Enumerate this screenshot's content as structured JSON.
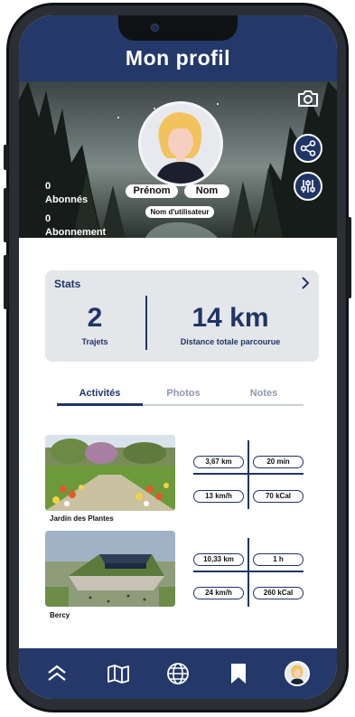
{
  "header": {
    "title": "Mon profil"
  },
  "profile": {
    "first_name": "Prénom",
    "last_name": "Nom",
    "username": "Nom d'utilisateur",
    "followers": {
      "count": "0",
      "label": "Abonnés"
    },
    "following": {
      "count": "0",
      "label": "Abonnement"
    },
    "icons": {
      "camera": "camera-icon",
      "share": "share-icon",
      "settings": "sliders-icon"
    }
  },
  "stats": {
    "label": "Stats",
    "trips": {
      "value": "2",
      "caption": "Trajets"
    },
    "distance": {
      "value": "14 km",
      "caption": "Distance totale parcourue"
    }
  },
  "tabs": [
    {
      "label": "Activités",
      "active": true
    },
    {
      "label": "Photos",
      "active": false
    },
    {
      "label": "Notes",
      "active": false
    }
  ],
  "trips": [
    {
      "name": "Jardin des Plantes",
      "distance": "3,67 km",
      "duration": "20 min",
      "speed": "13 km/h",
      "calories": "70 kCal"
    },
    {
      "name": "Bercy",
      "distance": "10,33 km",
      "duration": "1 h",
      "speed": "24 km/h",
      "calories": "260 kCal"
    }
  ],
  "bottom_nav": [
    "chevrons-up-icon",
    "map-icon",
    "globe-icon",
    "bookmark-icon",
    "profile-avatar"
  ],
  "colors": {
    "primary": "#24396a",
    "card": "#e4e6ea",
    "inactive_tab": "#8e99b0"
  }
}
